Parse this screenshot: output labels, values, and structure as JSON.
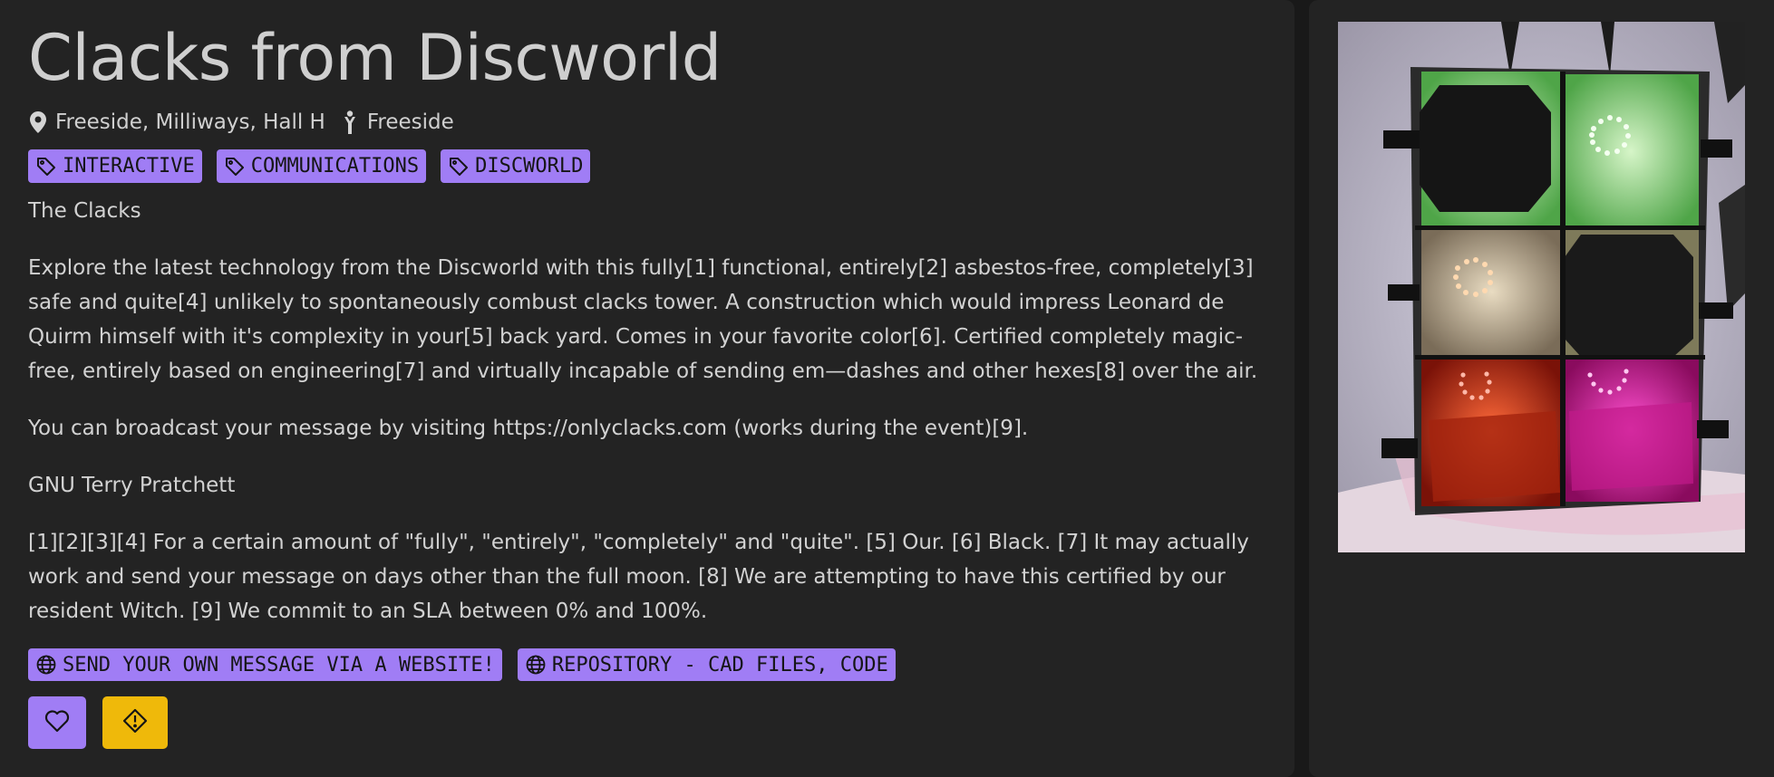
{
  "project": {
    "title": "Clacks from Discworld",
    "location": "Freeside, Milliways, Hall H",
    "organizer": "Freeside",
    "location_icon": "map-pin-icon",
    "organizer_icon": "person-icon"
  },
  "tags": [
    {
      "label": "INTERACTIVE",
      "icon": "tag-icon"
    },
    {
      "label": "COMMUNICATIONS",
      "icon": "tag-icon"
    },
    {
      "label": "DISCWORLD",
      "icon": "tag-icon"
    }
  ],
  "description": {
    "subtitle": "The Clacks",
    "paragraph1": "Explore the latest technology from the Discworld with this fully[1] functional, entirely[2] asbestos-free, completely[3] safe and quite[4] unlikely to spontaneously combust clacks tower. A construction which would impress Leonard de Quirm himself with it's complexity in your[5] back yard. Comes in your favorite color[6]. Certified completely magic-free, entirely based on engineering[7] and virtually incapable of sending em—dashes and other hexes[8] over the air.",
    "paragraph2": "You can broadcast your message by visiting https://onlyclacks.com (works during the event)[9].",
    "paragraph3": "GNU Terry Pratchett",
    "footnotes": "[1][2][3][4] For a certain amount of \"fully\", \"entirely\", \"completely\" and \"quite\". [5] Our. [6] Black. [7] It may actually work and send your message on days other than the full moon. [8] We are attempting to have this certified by our resident Witch. [9] We commit to an SLA between 0% and 100%."
  },
  "links": [
    {
      "label": "SEND YOUR OWN MESSAGE VIA A WEBSITE!",
      "icon": "globe-icon"
    },
    {
      "label": "REPOSITORY - CAD FILES, CODE",
      "icon": "globe-icon"
    }
  ],
  "actions": {
    "favorite_icon": "heart-icon",
    "report_icon": "warning-icon"
  },
  "colors": {
    "accent": "#a07df5",
    "warning": "#efb90a",
    "panel": "#232323",
    "background": "#191919"
  },
  "image": {
    "subject": "clacks-tower-photo"
  }
}
